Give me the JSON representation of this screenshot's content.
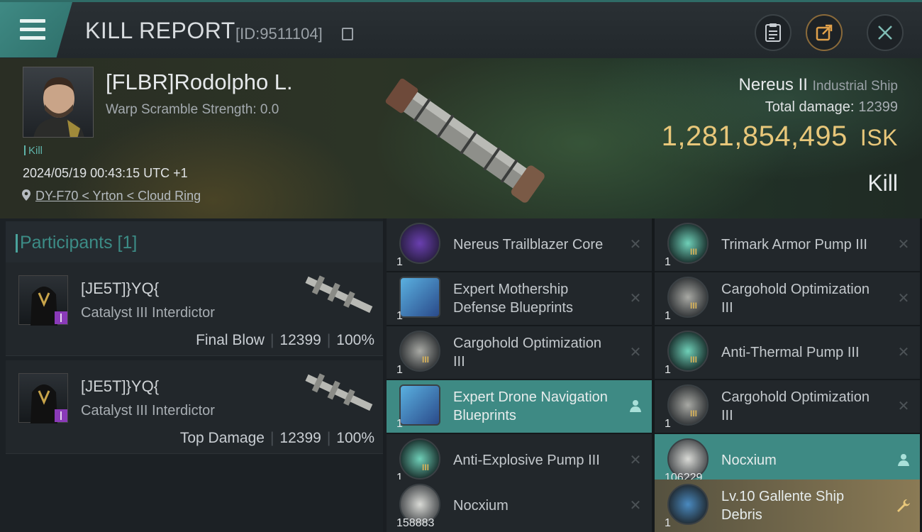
{
  "header": {
    "title": "KILL REPORT",
    "id_label": "[ID:9511104]"
  },
  "hero": {
    "player_name": "[FLBR]Rodolpho L.",
    "warp_scramble": "Warp Scramble Strength: 0.0",
    "kill_tag": "Kill",
    "datetime": "2024/05/19 00:43:15 UTC +1",
    "location": "DY-F70 < Yrton < Cloud Ring",
    "ship_name": "Nereus II",
    "ship_class": "Industrial Ship",
    "total_damage_label": "Total damage:",
    "total_damage_value": "12399",
    "isk_value": "1,281,854,495",
    "isk_unit": "ISK",
    "result": "Kill"
  },
  "participants": {
    "header": "Participants [1]",
    "rows": [
      {
        "name": "[JE5T]}YQ{",
        "ship": "Catalyst III Interdictor",
        "role": "Final Blow",
        "damage": "12399",
        "percent": "100%"
      },
      {
        "name": "[JE5T]}YQ{",
        "ship": "Catalyst III Interdictor",
        "role": "Top Damage",
        "damage": "12399",
        "percent": "100%"
      }
    ]
  },
  "items": [
    {
      "name": "Nereus Trailblazer Core",
      "qty": "1",
      "icon": "core-icon",
      "action": "close-icon"
    },
    {
      "name": "Trimark Armor Pump III",
      "qty": "1",
      "icon": "rig-icon",
      "action": "close-icon"
    },
    {
      "name": "Expert Mothership Defense Blueprints",
      "qty": "1",
      "icon": "blueprint-icon",
      "action": "close-icon"
    },
    {
      "name": "Cargohold Optimization III",
      "qty": "1",
      "icon": "cargohold-icon",
      "action": "close-icon"
    },
    {
      "name": "Cargohold Optimization III",
      "qty": "1",
      "icon": "cargohold-icon",
      "action": "close-icon"
    },
    {
      "name": "Anti-Thermal Pump III",
      "qty": "1",
      "icon": "rig-icon",
      "action": "close-icon"
    },
    {
      "name": "Expert Drone Navigation Blueprints",
      "qty": "1",
      "icon": "blueprint-icon",
      "action": "person-icon"
    },
    {
      "name": "Cargohold Optimization III",
      "qty": "1",
      "icon": "cargohold-icon",
      "action": "close-icon"
    },
    {
      "name": "Anti-Explosive Pump III",
      "qty": "1",
      "icon": "rig-icon",
      "action": "close-icon"
    },
    {
      "name": "Nocxium",
      "qty": "106229",
      "icon": "ore-icon",
      "action": "person-icon"
    },
    {
      "name": "Nocxium",
      "qty": "158883",
      "icon": "ore-icon",
      "action": "close-icon"
    },
    {
      "name": "Lv.10 Gallente Ship Debris",
      "qty": "1",
      "icon": "debris-icon",
      "action": "wrench-icon"
    }
  ]
}
